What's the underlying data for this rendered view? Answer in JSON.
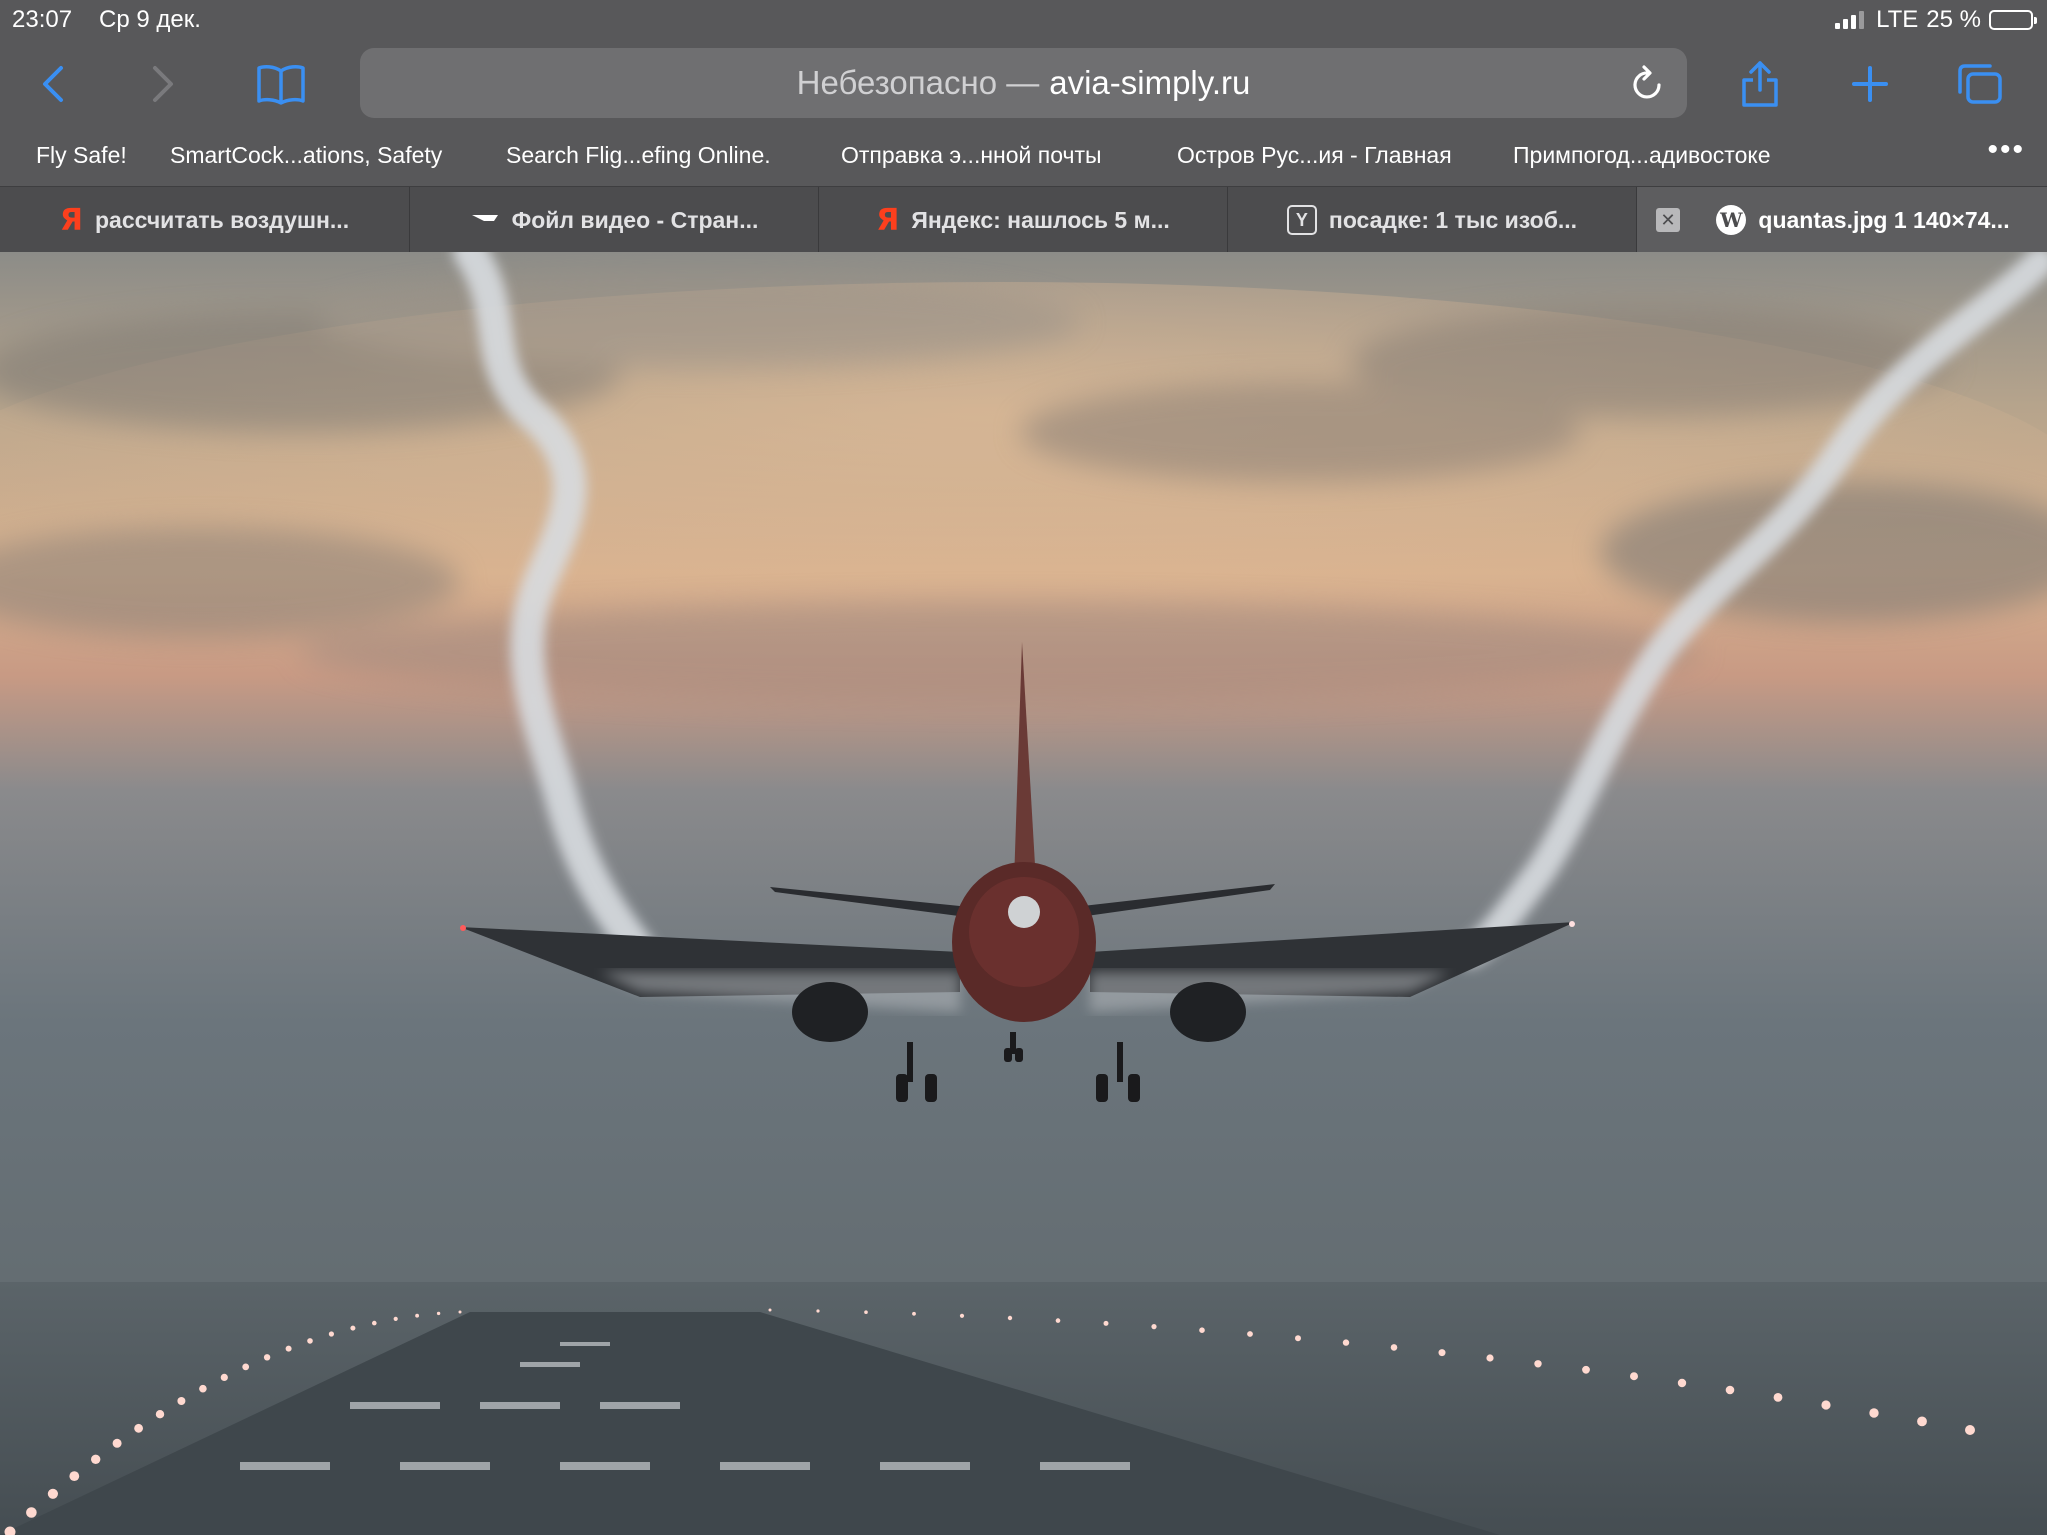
{
  "status_bar": {
    "time": "23:07",
    "date": "Ср 9 дек.",
    "network": "LTE",
    "battery_text": "25 %",
    "battery_level": 0.25
  },
  "toolbar": {
    "address_warning": "Небезопасно —",
    "address_domain": "avia-simply.ru",
    "accent_color": "#3a8ff2"
  },
  "favorites": [
    {
      "label": "Fly Safe!"
    },
    {
      "label": "SmartCock...ations, Safety"
    },
    {
      "label": "Search Flig...efing Online."
    },
    {
      "label": "Отправка э...нной почты"
    },
    {
      "label": "Остров Рус...ия - Главная"
    },
    {
      "label": "Примпогод...адивостоке"
    }
  ],
  "tabs": [
    {
      "label": "рассчитать воздушн...",
      "icon": "yandex-icon"
    },
    {
      "label": "Фойл видео - Стран...",
      "icon": "video-icon"
    },
    {
      "label": "Яндекс: нашлось 5 м...",
      "icon": "yandex-icon"
    },
    {
      "label": "посадке: 1 тыс изоб...",
      "icon": "y-box-icon"
    },
    {
      "label": "quantas.jpg 1 140×74...",
      "icon": "wordpress-icon",
      "active": true
    }
  ],
  "photo": {
    "subject": "airliner-landing-wingtip-vortices"
  }
}
